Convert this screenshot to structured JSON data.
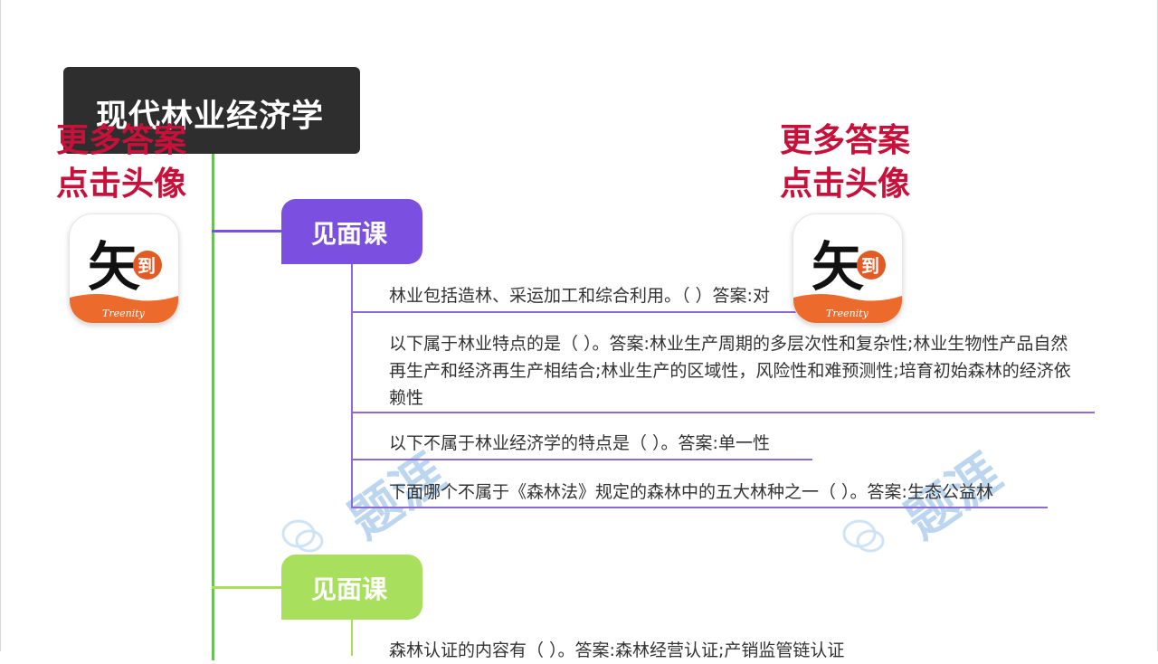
{
  "mindmap": {
    "root": {
      "label": "现代林业经济学"
    },
    "branches": [
      {
        "label": "见面课",
        "color": "#7b4fe0",
        "items": [
          "林业包括造林、采运加工和综合利用。（ ）答案:对",
          "以下属于林业特点的是（ ）。答案:林业生产周期的多层次性和复杂性;林业生物性产品自然再生产和经济再生产相结合;林业生产的区域性，风险性和难预测性;培育初始森林的经济依赖性",
          "以下不属于林业经济学的特点是（ ）。答案:单一性",
          "下面哪个不属于《森林法》规定的森林中的五大林种之一（ ）。答案:生态公益林"
        ]
      },
      {
        "label": "见面课",
        "color": "#a8e05e",
        "items": [
          "森林认证的内容有（ ）。答案:森林经营认证;产销监管链认证"
        ]
      }
    ]
  },
  "promo": {
    "line1": "更多答案",
    "line2": "点击头像",
    "color": "#c8103a"
  },
  "avatar": {
    "logo_char": "矢",
    "seal_char": "到",
    "brand": "Treenity"
  },
  "watermark": {
    "text": "题涯"
  },
  "colors": {
    "root_bg": "#2e2e2e",
    "trunk": "#6cc05a",
    "branch1": "#7b4fe0",
    "branch2": "#a8e05e",
    "leaf_line": "#8c6bd8"
  }
}
